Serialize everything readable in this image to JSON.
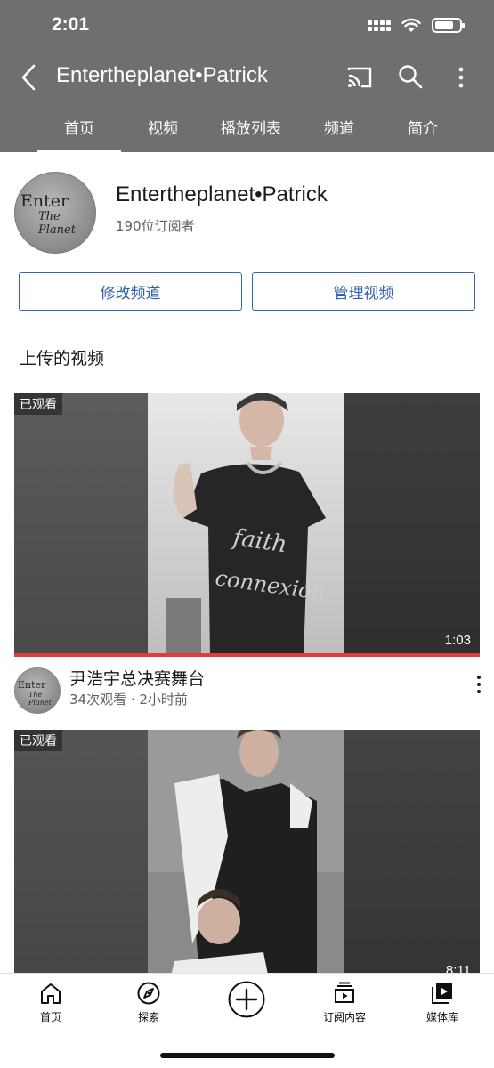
{
  "status": {
    "time": "2:01"
  },
  "appbar": {
    "title": "Entertheplanet•Patrick"
  },
  "tabs": [
    {
      "label": "首页",
      "active": true
    },
    {
      "label": "视频"
    },
    {
      "label": "播放列表"
    },
    {
      "label": "频道"
    },
    {
      "label": "简介"
    }
  ],
  "channel": {
    "name": "Entertheplanet•Patrick",
    "subscribers": "190位订阅者",
    "logo_text_1": "Enter",
    "logo_text_2": "The Planet",
    "edit_button": "修改频道",
    "manage_button": "管理视频"
  },
  "section_title": "上传的视频",
  "videos": [
    {
      "watched_badge": "已观看",
      "duration": "1:03",
      "title": "尹浩宇总决赛舞台",
      "meta": "34次观看 · 2小时前",
      "watch_progress": 1.0
    },
    {
      "watched_badge": "已观看",
      "duration": "8:11"
    }
  ],
  "bottom_nav": [
    {
      "label": "首页",
      "icon": "home-icon"
    },
    {
      "label": "探索",
      "icon": "explore-icon"
    },
    {
      "label": "",
      "icon": "create-icon"
    },
    {
      "label": "订阅内容",
      "icon": "subscriptions-icon"
    },
    {
      "label": "媒体库",
      "icon": "library-icon"
    }
  ],
  "colors": {
    "header_bg": "#6f6f6f",
    "button_blue": "#2f5fb0",
    "progress_red": "#e03c3c"
  }
}
